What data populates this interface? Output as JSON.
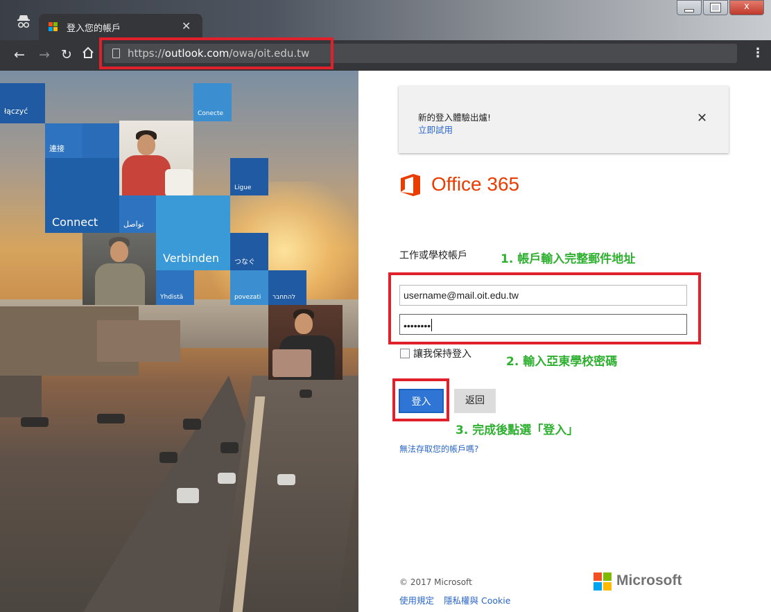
{
  "browser": {
    "tab_title": "登入您的帳戶",
    "url_prefix": "https://",
    "url_domain": "outlook.com",
    "url_path": "/owa/oit.edu.tw",
    "icons": [
      "incognito-icon",
      "back-icon",
      "forward-icon",
      "reload-icon",
      "home-icon",
      "page-icon",
      "menu-icon",
      "close-tab-icon"
    ],
    "window_close": "x"
  },
  "hero": {
    "tiles": [
      "łączyć",
      "Conecte",
      "連接",
      "Ligue",
      "Connect",
      "تواصل",
      "Verbinden",
      "つなぐ",
      "Yhdistä",
      "povezati",
      "להתחבר"
    ]
  },
  "notice": {
    "message": "新的登入體驗出爐!",
    "try_link": "立即試用"
  },
  "brand": {
    "product": "Office 365",
    "accent": "#eb3c00"
  },
  "login": {
    "account_label": "工作或學校帳戶",
    "username_value": "username@mail.oit.edu.tw",
    "password_value": "••••••••",
    "keep_signed_in": "讓我保持登入",
    "sign_in_button": "登入",
    "back_button": "返回",
    "cant_access": "無法存取您的帳戶嗎?"
  },
  "annotations": {
    "step1": "1. 帳戶輸入完整郵件地址",
    "step2": "2. 輸入亞東學校密碼",
    "step3": "3. 完成後點選「登入」",
    "color": "#2fb030",
    "box_color": "#e0202a"
  },
  "footer": {
    "copyright": "© 2017 Microsoft",
    "terms": "使用規定",
    "privacy": "隱私權與 Cookie",
    "microsoft": "Microsoft"
  }
}
